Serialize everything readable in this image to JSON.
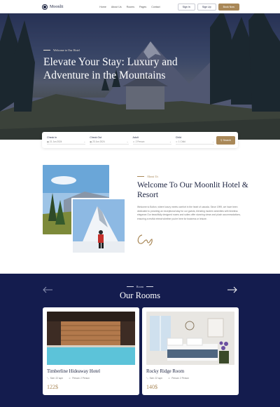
{
  "brand": {
    "name": "Moonlit"
  },
  "nav": {
    "items": [
      "Home",
      "About Us",
      "Rooms",
      "Pages",
      "Contact"
    ],
    "sign_in": "Sign In",
    "sign_up": "Sign Up",
    "book_now": "Book Now"
  },
  "hero": {
    "subtitle": "Welcome to Our Hotel",
    "title": "Elevate Your Stay: Luxury and Adventure in the Mountains"
  },
  "booking": {
    "check_in": {
      "label": "Check In",
      "value": "21 Jun 2024"
    },
    "check_out": {
      "label": "Check Out",
      "value": "23 Jun 2024"
    },
    "adult": {
      "label": "Adult",
      "value": "2 Person"
    },
    "child": {
      "label": "Child",
      "value": "1 Child"
    },
    "search": "Search"
  },
  "about": {
    "subtitle": "About Us",
    "title": "Welcome To Our Moonlit Hotel & Resort",
    "text": "Welcome to Bolton, where luxury meets comfort in the heart of canada. Since 1999, we have been dedicated to providing an exceptional stay for our guests, blending modern amenities with timeless elegance.Our beautifully designed rooms and suites offer stunning views and plush accommodations, ensuring a restful retreat whether you're here for business or leisure.",
    "signature": "Cay"
  },
  "rooms": {
    "subtitle": "Room",
    "title": "Our Rooms",
    "cards": [
      {
        "name": "Timberline Hideaway Hotel",
        "size": "Size: 22 sqm",
        "persons": "Person: 2 Person",
        "price": "122$"
      },
      {
        "name": "Rocky Ridge Room",
        "size": "Size: 22 sqm",
        "persons": "Person: 2 Person",
        "price": "140$"
      }
    ]
  },
  "colors": {
    "navy": "#141c4e",
    "gold": "#a98858",
    "text": "#1c2340"
  }
}
